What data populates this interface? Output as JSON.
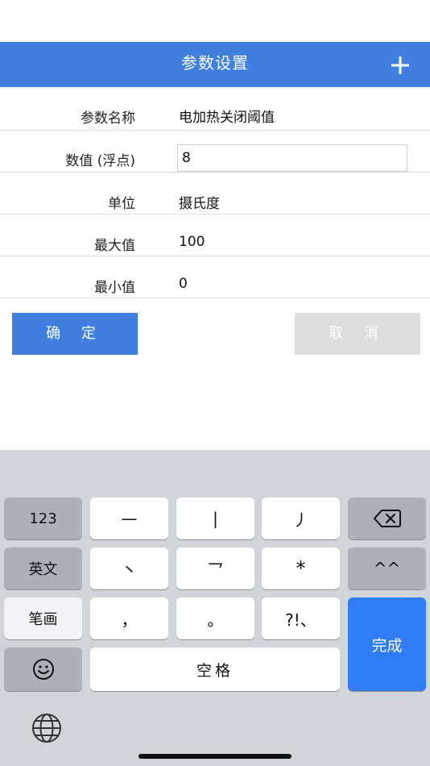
{
  "header": {
    "title": "参数设置",
    "add_icon": "plus-icon"
  },
  "form": {
    "rows": [
      {
        "label": "参数名称",
        "value": "电加热关闭阈值"
      },
      {
        "label": "数值 (浮点)",
        "value": "8"
      },
      {
        "label": "单位",
        "value": "摄氏度"
      },
      {
        "label": "最大值",
        "value": "100"
      },
      {
        "label": "最小值",
        "value": "0"
      }
    ]
  },
  "actions": {
    "confirm": "确 定",
    "cancel": "取 消"
  },
  "keyboard": {
    "row1": [
      "123",
      "—",
      "|",
      "丿",
      "backspace-icon"
    ],
    "row2": [
      "英文",
      "丶",
      "乛",
      "*",
      "^^"
    ],
    "row3": [
      "笔画",
      "，",
      "。",
      "?!、"
    ],
    "row4": [
      "emoji-icon",
      "空格"
    ],
    "done": "完成",
    "globe_icon": "globe-icon"
  },
  "colors": {
    "accent": "#3f7fe0",
    "keyboard_bg": "#d1d4d9",
    "done_key": "#2f7cf6",
    "cancel_bg": "#dedede"
  }
}
